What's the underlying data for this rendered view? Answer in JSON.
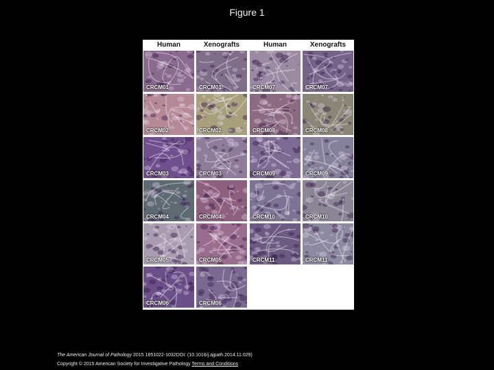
{
  "title": "Figure 1",
  "headers": [
    "Human",
    "Xenografts",
    "Human",
    "Xenografts"
  ],
  "tiles": [
    {
      "label": "CRCM01",
      "color": "#8a6a8e"
    },
    {
      "label": "CRCM01",
      "color": "#7f6d8a"
    },
    {
      "label": "CRCM07",
      "color": "#9a8aa2"
    },
    {
      "label": "CRCM07",
      "color": "#75638a"
    },
    {
      "label": "CRCM02",
      "color": "#b58a96"
    },
    {
      "label": "CRCM02",
      "color": "#a8a07a"
    },
    {
      "label": "CRCM08",
      "color": "#8c6a80"
    },
    {
      "label": "CRCM08",
      "color": "#8a8676"
    },
    {
      "label": "CRCM03",
      "color": "#6f4f8e"
    },
    {
      "label": "CRCM03",
      "color": "#8e7c9a"
    },
    {
      "label": "CRCM09",
      "color": "#7e6b94"
    },
    {
      "label": "CRCM09",
      "color": "#86819a"
    },
    {
      "label": "CRCM04",
      "color": "#5d6a74"
    },
    {
      "label": "CRCM04",
      "color": "#8e5f7e"
    },
    {
      "label": "CRCM10",
      "color": "#7d7394"
    },
    {
      "label": "CRCM10",
      "color": "#8a8696"
    },
    {
      "label": "CRCM05",
      "color": "#aa9cb0"
    },
    {
      "label": "CRCM05",
      "color": "#9a6c8e"
    },
    {
      "label": "CRCM11",
      "color": "#6b5a82"
    },
    {
      "label": "CRCM11",
      "color": "#8c8aa0"
    },
    {
      "label": "CRCM06",
      "color": "#6a4f88"
    },
    {
      "label": "CRCM06",
      "color": "#7a6a92"
    }
  ],
  "footer": {
    "journal": "The American Journal of Pathology",
    "citation": " 2015 1851022-1032DOI: (10.1016/j.ajpath.2014.11.029)",
    "copyright": "Copyright © 2015 American Society for Investigative Pathology ",
    "terms_link": "Terms and Conditions"
  }
}
